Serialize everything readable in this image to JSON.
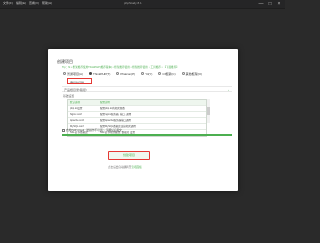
{
  "titlebar": {
    "menus": [
      "文件(F)",
      "编辑(E)",
      "查看(V)",
      "帮助(H)"
    ],
    "title": "phpStudy 8.1",
    "buttons": [
      "—",
      "□",
      "×"
    ]
  },
  "dialog": {
    "title": "创建项目",
    "hint": "Tip：ht • 框架推荐使用ThinkPHP(推荐版本) • 框架推荐使用 • 框架推荐使用 ↓ 工具推荐 • 【下载推荐】",
    "project_types": [
      {
        "label": "普通项目(A)",
        "checked": false
      },
      {
        "label": "ThinkPHP(T)",
        "checked": true
      },
      {
        "label": "Phalcon(P)",
        "checked": false
      },
      {
        "label": "Yii(Y)",
        "checked": false
      },
      {
        "label": "CI框架(C)",
        "checked": false
      },
      {
        "label": "其他框架(O)",
        "checked": false
      }
    ],
    "project_name": "demo.cms",
    "path_label": "产品根目录/路径/",
    "path_arrow": "›",
    "section_label": "基础设置",
    "table": {
      "headers": [
        "默认选项",
        "配置说明"
      ],
      "rows": [
        [
          "php.ini设置",
          "配置php.ini的相关参数"
        ],
        [
          "Nginx.conf",
          "配置nginx服务器, 端口, 通用"
        ],
        [
          "Apache.conf",
          "配置Apache服务器端口通用"
        ],
        [
          "MySQL.conf",
          "配置MySQL数据库连接相关通用"
        ],
        [
          "SSL证书/数据库",
          "SSL证书/密钥配置, 数据库 设置"
        ]
      ]
    },
    "checkbox_label": "启用PHP-Cloud（此操作不可逆），请确认后提交",
    "submit_label": "创建项目",
    "footer_text": "点击后会自动跳转至",
    "footer_link": "宝塔面板"
  }
}
